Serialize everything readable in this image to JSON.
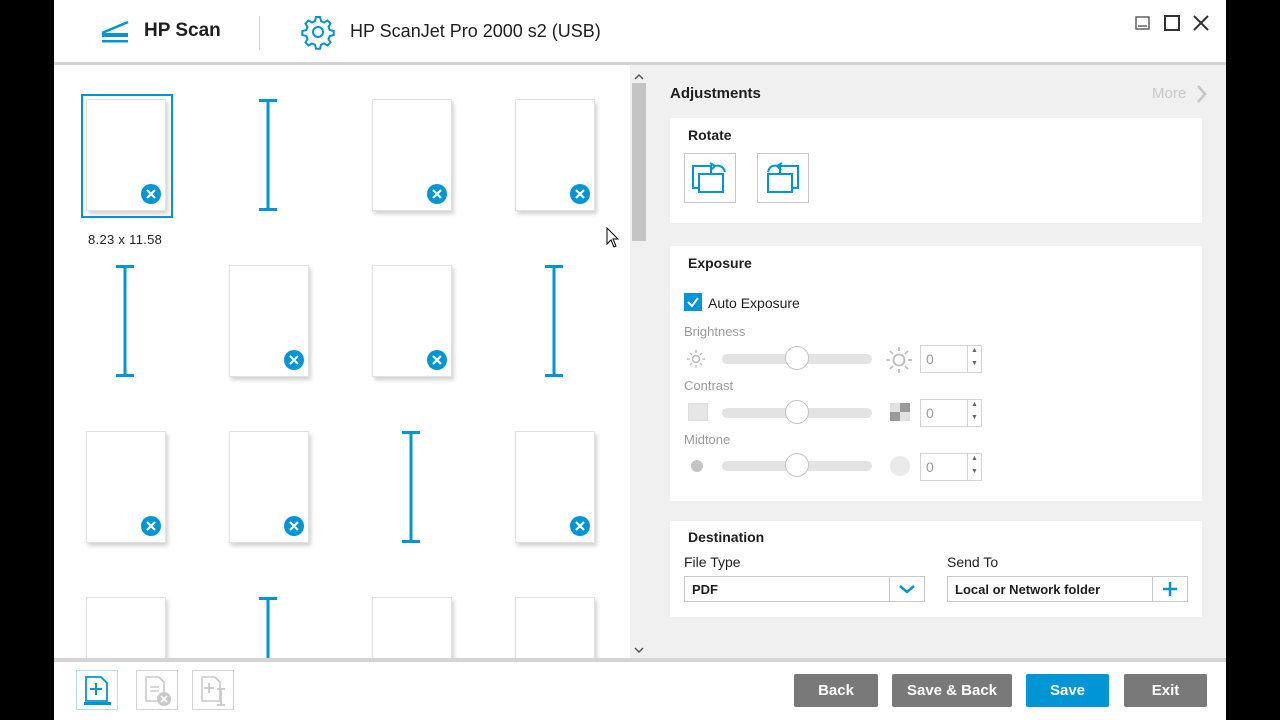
{
  "app": {
    "title": "HP Scan",
    "device": "HP ScanJet Pro 2000 s2 (USB)",
    "accent_color": "#0096d6",
    "icons": {
      "app": "scanner-icon",
      "device": "gear-icon",
      "minimize": "minimize-icon",
      "maximize": "maximize-icon",
      "close": "close-icon"
    }
  },
  "thumbnails": {
    "selected_dimensions": "8.23 x 11.58",
    "grid": [
      [
        "page",
        "separator",
        "page",
        "page"
      ],
      [
        "separator",
        "page",
        "page",
        "separator"
      ],
      [
        "page",
        "page",
        "separator",
        "page"
      ],
      [
        "page",
        "separator",
        "page",
        "page"
      ]
    ]
  },
  "adjustments": {
    "title": "Adjustments",
    "more_label": "More",
    "rotate": {
      "title": "Rotate",
      "left_icon": "rotate-left-icon",
      "right_icon": "rotate-right-icon"
    },
    "exposure": {
      "title": "Exposure",
      "auto_label": "Auto Exposure",
      "auto_checked": true,
      "brightness": {
        "label": "Brightness",
        "value": "0",
        "slider_level": 0.5
      },
      "contrast": {
        "label": "Contrast",
        "value": "0",
        "slider_level": 0.5
      },
      "midtone": {
        "label": "Midtone",
        "value": "0",
        "slider_level": 0.5
      }
    },
    "destination": {
      "title": "Destination",
      "file_type_label": "File Type",
      "file_type_value": "PDF",
      "send_to_label": "Send To",
      "send_to_value": "Local or Network folder"
    }
  },
  "bottom": {
    "tools": [
      "add-page-icon",
      "delete-page-icon",
      "insert-separator-icon"
    ],
    "buttons": {
      "back": "Back",
      "save_back": "Save & Back",
      "save": "Save",
      "exit": "Exit"
    }
  }
}
